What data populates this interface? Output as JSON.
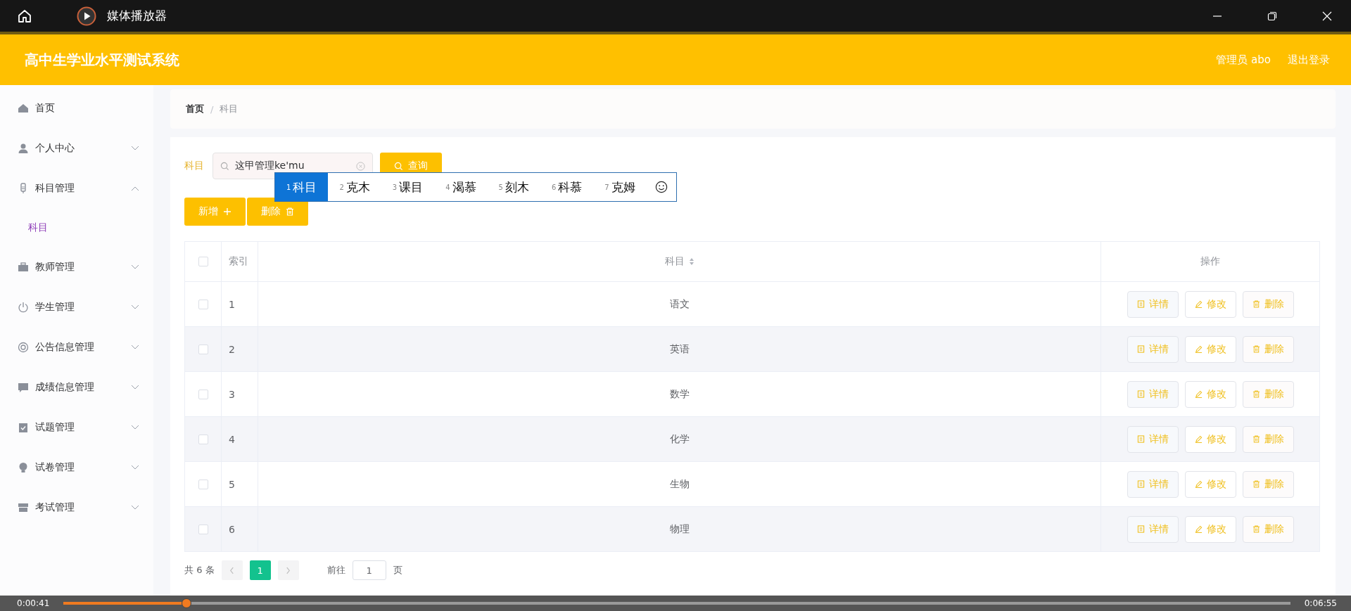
{
  "player": {
    "title": "媒体播放器",
    "elapsed": "0:00:41",
    "total": "0:06:55",
    "level": 0.1
  },
  "app": {
    "title": "高中生学业水平测试系统",
    "user": "管理员 abo",
    "logout": "退出登录"
  },
  "sidebar": {
    "items": [
      {
        "label": "首页",
        "kind": "link"
      },
      {
        "label": "个人中心",
        "kind": "menu",
        "expanded": false
      },
      {
        "label": "科目管理",
        "kind": "menu",
        "expanded": true,
        "children": [
          {
            "label": "科目",
            "selected": true
          }
        ]
      },
      {
        "label": "教师管理",
        "kind": "menu",
        "expanded": false
      },
      {
        "label": "学生管理",
        "kind": "menu",
        "expanded": false
      },
      {
        "label": "公告信息管理",
        "kind": "menu",
        "expanded": false
      },
      {
        "label": "成绩信息管理",
        "kind": "menu",
        "expanded": false
      },
      {
        "label": "试题管理",
        "kind": "menu",
        "expanded": false
      },
      {
        "label": "试卷管理",
        "kind": "menu",
        "expanded": false
      },
      {
        "label": "考试管理",
        "kind": "menu",
        "expanded": false
      }
    ]
  },
  "breadcrumb": {
    "items": [
      "首页",
      "科目"
    ],
    "separator": "/"
  },
  "search": {
    "label": "科目",
    "value": "这甲管理ke'mu",
    "button": "查询"
  },
  "ime": {
    "candidates": [
      {
        "index": "1",
        "text": "科目",
        "selected": true
      },
      {
        "index": "2",
        "text": "克木",
        "selected": false
      },
      {
        "index": "3",
        "text": "课目",
        "selected": false
      },
      {
        "index": "4",
        "text": "渴慕",
        "selected": false
      },
      {
        "index": "5",
        "text": "刻木",
        "selected": false
      },
      {
        "index": "6",
        "text": "科慕",
        "selected": false
      },
      {
        "index": "7",
        "text": "克姆",
        "selected": false
      }
    ]
  },
  "toolbar": {
    "add": "新增",
    "delete": "删除"
  },
  "table": {
    "columns": [
      "索引",
      "科目",
      "操作"
    ],
    "select_all": {
      "checked": false
    },
    "rows": [
      {
        "index": "1",
        "subject": "语文",
        "checked": false,
        "actions": [
          "详情",
          "修改",
          "删除"
        ]
      },
      {
        "index": "2",
        "subject": "英语",
        "checked": false,
        "actions": [
          "详情",
          "修改",
          "删除"
        ]
      },
      {
        "index": "3",
        "subject": "数学",
        "checked": false,
        "actions": [
          "详情",
          "修改",
          "删除"
        ]
      },
      {
        "index": "4",
        "subject": "化学",
        "checked": false,
        "actions": [
          "详情",
          "修改",
          "删除"
        ]
      },
      {
        "index": "5",
        "subject": "生物",
        "checked": false,
        "actions": [
          "详情",
          "修改",
          "删除"
        ]
      },
      {
        "index": "6",
        "subject": "物理",
        "checked": false,
        "actions": [
          "详情",
          "修改",
          "删除"
        ]
      }
    ]
  },
  "pagination": {
    "total": "共 6 条",
    "pages": [
      {
        "label": "1",
        "selected": true
      }
    ],
    "goto": "前往",
    "page_input": "1",
    "page_unit": "页"
  }
}
